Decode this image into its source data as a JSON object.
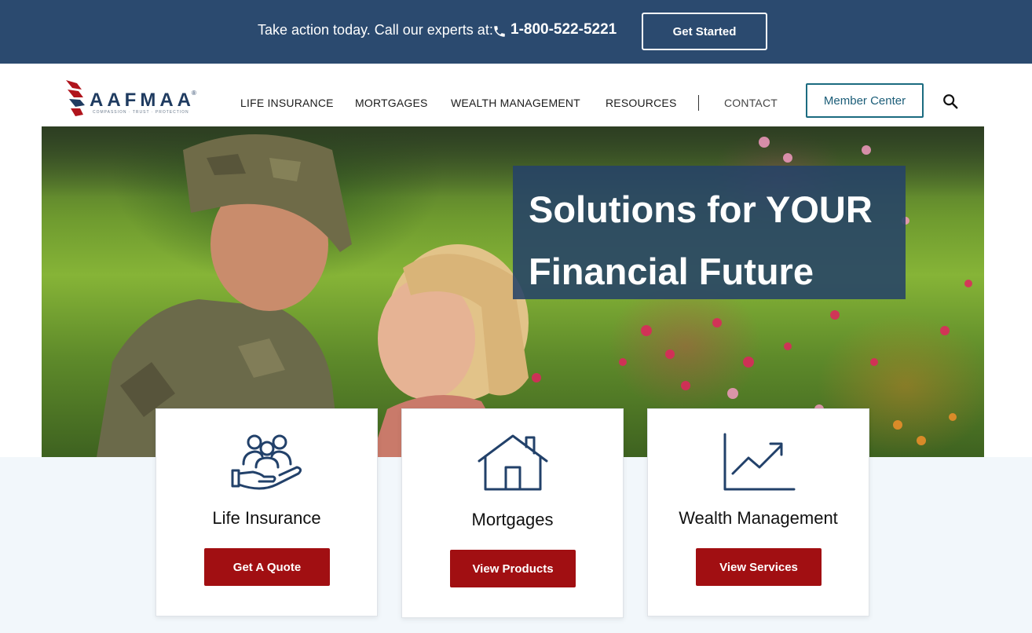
{
  "topbar": {
    "cta_text": "Take action today. Call our experts at:",
    "phone": "1-800-522-5221",
    "button_label": "Get Started"
  },
  "logo": {
    "name": "AAFMAA",
    "registered": "®",
    "tagline": "COMPASSION · TRUST · PROTECTION"
  },
  "nav": {
    "items": [
      {
        "label": "LIFE INSURANCE"
      },
      {
        "label": "MORTGAGES"
      },
      {
        "label": "WEALTH MANAGEMENT"
      },
      {
        "label": "RESOURCES"
      },
      {
        "label": "CONTACT"
      }
    ],
    "member_center": "Member Center",
    "search_icon": "search-icon"
  },
  "hero": {
    "headline_line1": "Solutions for YOUR",
    "headline_line2": "Financial Future"
  },
  "cards": [
    {
      "title": "Life Insurance",
      "button": "Get A Quote",
      "icon": "family-hand-icon"
    },
    {
      "title": "Mortgages",
      "button": "View Products",
      "icon": "house-icon"
    },
    {
      "title": "Wealth Management",
      "button": "View Services",
      "icon": "growth-chart-icon"
    }
  ],
  "colors": {
    "topbar": "#2b4a6f",
    "navy": "#1f3b60",
    "accent_red": "#a10f12",
    "teal": "#1b6b80",
    "band": "#f2f7fb"
  }
}
